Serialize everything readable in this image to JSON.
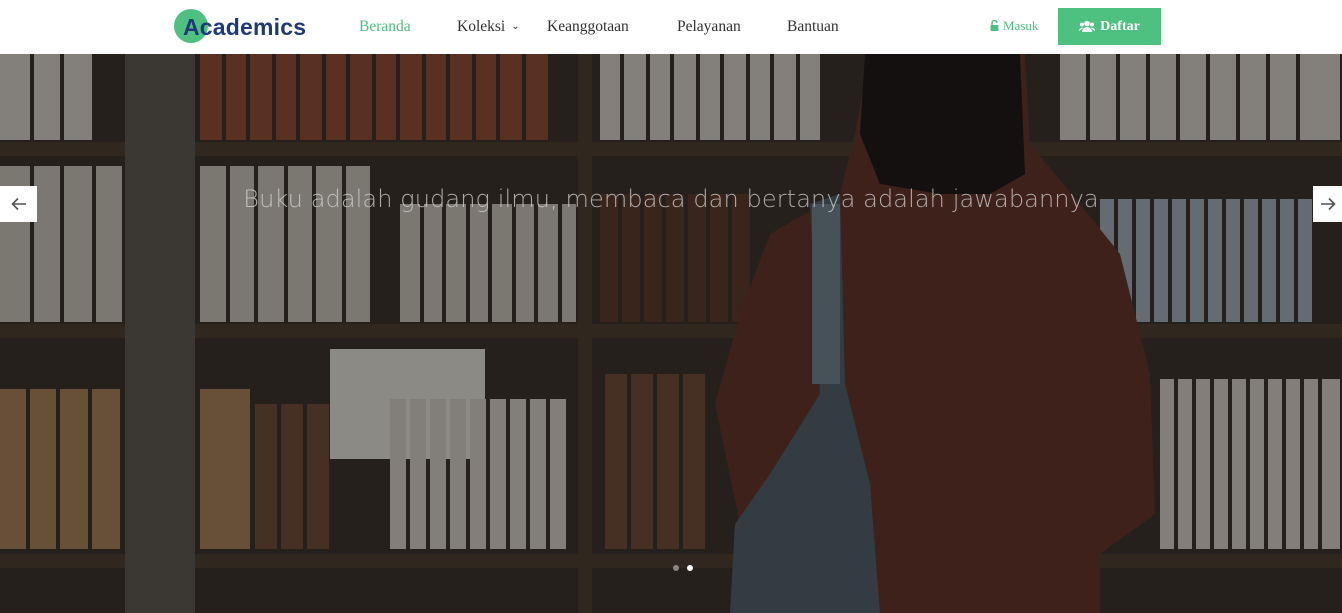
{
  "brand": {
    "name": "Academics",
    "color": "#4ec080",
    "text_color": "#1f3a78"
  },
  "nav": {
    "items": [
      {
        "label": "Beranda",
        "active": true
      },
      {
        "label": "Koleksi",
        "has_dropdown": true,
        "icon": "chevron-down-icon"
      },
      {
        "label": "Keanggotaan"
      },
      {
        "label": "Pelayanan"
      },
      {
        "label": "Bantuan"
      }
    ]
  },
  "auth": {
    "login_label": "Masuk",
    "login_icon": "lock-icon",
    "register_label": "Daftar",
    "register_icon": "users-icon"
  },
  "hero": {
    "caption": "Buku adalah gudang ilmu, membaca dan bertanya adalah jawabannya",
    "prev_icon": "arrow-left-icon",
    "next_icon": "arrow-right-icon",
    "slide_count": 2,
    "active_slide": 2
  },
  "colors": {
    "accent": "#4ec080",
    "nav_text": "#333333"
  }
}
